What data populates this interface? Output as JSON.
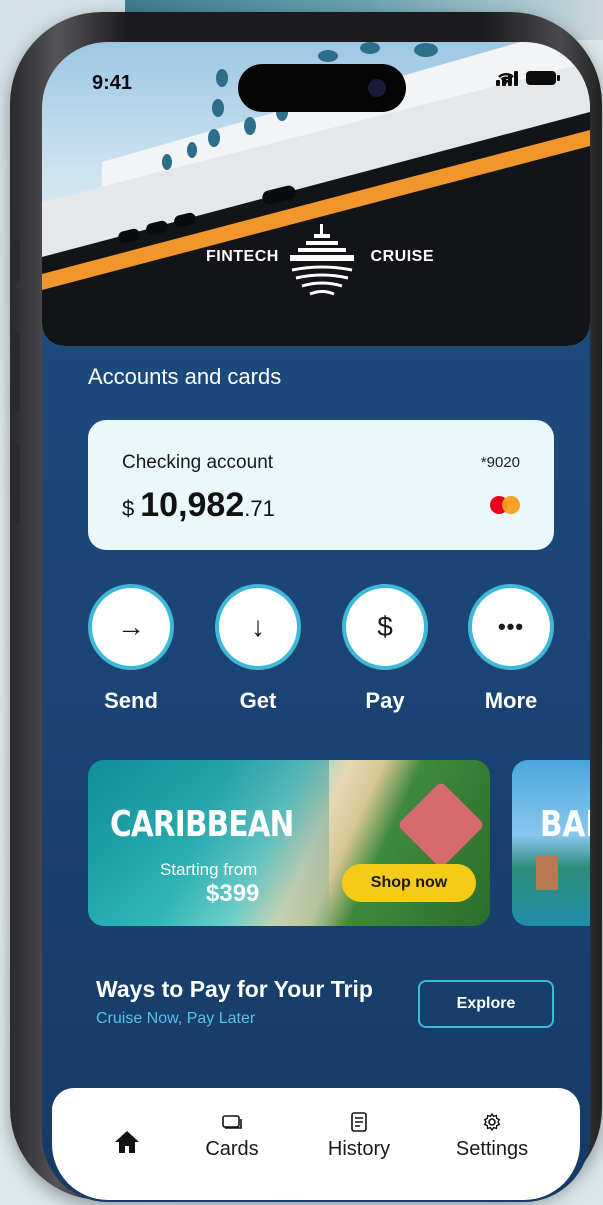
{
  "status_bar": {
    "time": "9:41"
  },
  "hero": {
    "brand_left": "FINTECH",
    "brand_right": "CRUISE"
  },
  "section_title": "Accounts and cards",
  "account": {
    "name": "Checking account",
    "masked_number": "*9020",
    "currency": "$",
    "balance_whole": "10,982",
    "balance_cents": ".71",
    "card_network_icon": "mastercard-icon"
  },
  "actions": [
    {
      "label": "Send",
      "icon": "arrow-right-icon",
      "glyph": "→"
    },
    {
      "label": "Get",
      "icon": "arrow-down-icon",
      "glyph": "↓"
    },
    {
      "label": "Pay",
      "icon": "dollar-icon",
      "glyph": "$"
    },
    {
      "label": "More",
      "icon": "more-icon",
      "glyph": "•••"
    }
  ],
  "promos": [
    {
      "title": "CARIBBEAN",
      "from_label": "Starting from",
      "price": "$399",
      "cta": "Shop now"
    },
    {
      "title": "BAH"
    }
  ],
  "pay_section": {
    "title": "Ways to Pay for Your Trip",
    "subtitle": "Cruise Now, Pay Later",
    "cta": "Explore"
  },
  "tabs": [
    {
      "label": "",
      "icon": "home-icon"
    },
    {
      "label": "Cards",
      "icon": "cards-icon"
    },
    {
      "label": "History",
      "icon": "history-icon"
    },
    {
      "label": "Settings",
      "icon": "settings-icon"
    }
  ],
  "colors": {
    "accent": "#3fb8d8",
    "background": "#1b4677",
    "cta_yellow": "#f6cb16",
    "card_bg": "#eaf7fb"
  }
}
